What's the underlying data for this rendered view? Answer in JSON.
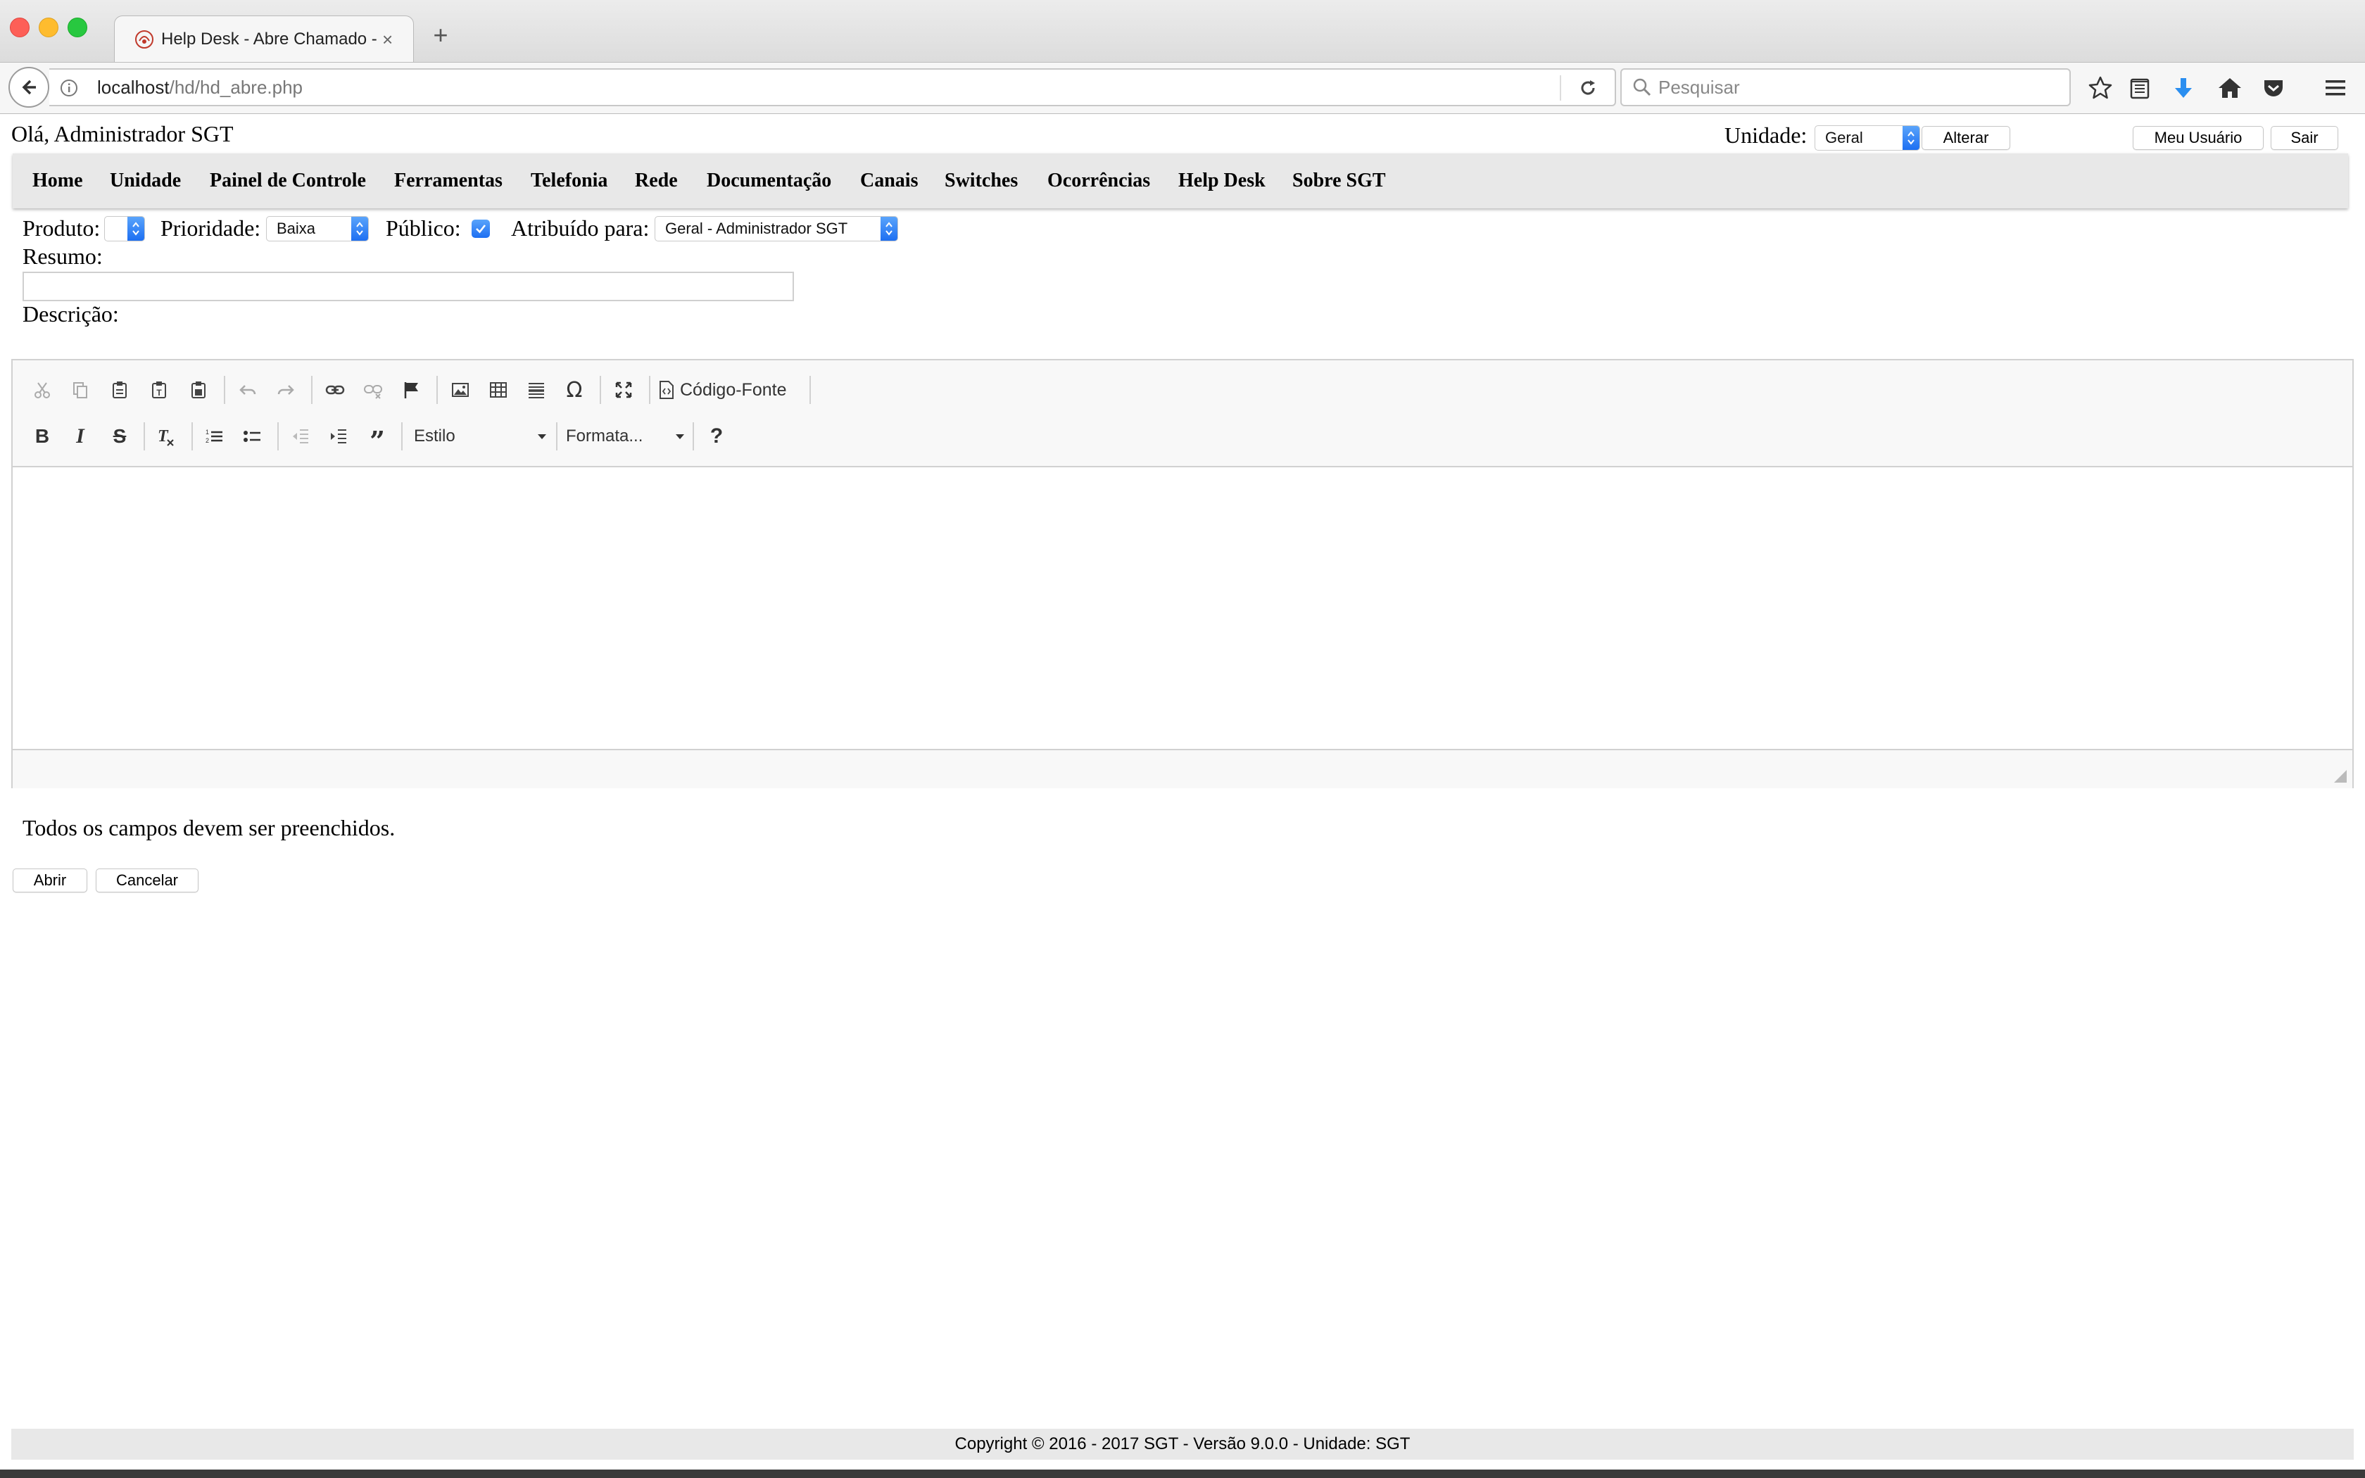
{
  "browser": {
    "tab_title": "Help Desk - Abre Chamado -",
    "tab_close": "×",
    "new_tab": "+",
    "url_host": "localhost",
    "url_path": "/hd/hd_abre.php",
    "search_placeholder": "Pesquisar"
  },
  "header": {
    "greeting": "Olá, Administrador SGT",
    "unidade_label": "Unidade:",
    "unidade_value": "Geral",
    "alterar_label": "Alterar",
    "meu_usuario_label": "Meu Usuário",
    "sair_label": "Sair"
  },
  "menu": {
    "items": [
      "Home",
      "Unidade",
      "Painel de Controle",
      "Ferramentas",
      "Telefonia",
      "Rede",
      "Documentação",
      "Canais",
      "Switches",
      "Ocorrências",
      "Help Desk",
      "Sobre SGT"
    ]
  },
  "form": {
    "produto_label": "Produto:",
    "produto_value": "",
    "prioridade_label": "Prioridade:",
    "prioridade_value": "Baixa",
    "publico_label": "Público:",
    "publico_checked": true,
    "atribuido_label": "Atribuído para:",
    "atribuido_value": "Geral - Administrador SGT",
    "resumo_label": "Resumo:",
    "resumo_value": "",
    "descricao_label": "Descrição:"
  },
  "editor": {
    "source_label": "Código-Fonte",
    "style_combo": "Estilo",
    "format_combo": "Formata...",
    "help_label": "?"
  },
  "notice": "Todos os campos devem ser preenchidos.",
  "actions": {
    "abrir_label": "Abrir",
    "cancelar_label": "Cancelar"
  },
  "footer": "Copyright © 2016 - 2017 SGT - Versão 9.0.0 - Unidade: SGT",
  "colors": {
    "accent_blue": "#1d6ff2",
    "menu_bg": "#e8e8e8",
    "download_arrow": "#2a8ef0"
  }
}
